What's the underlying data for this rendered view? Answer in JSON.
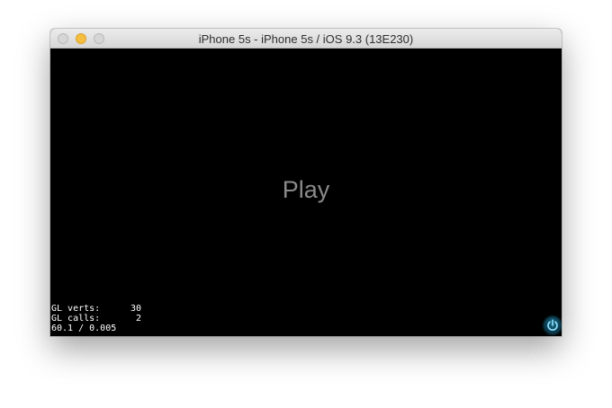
{
  "window": {
    "title": "iPhone 5s - iPhone 5s / iOS 9.3 (13E230)"
  },
  "screen": {
    "play_label": "Play",
    "stats": {
      "gl_verts_label": "GL verts:",
      "gl_verts_value": "30",
      "gl_calls_label": "GL calls:",
      "gl_calls_value": "2",
      "fps_line": "60.1 / 0.005"
    },
    "power_icon": "power-icon"
  },
  "colors": {
    "traffic_minimize": "#f5be3f",
    "screen_background": "#000000",
    "play_text": "#8a8a8a",
    "power_accent": "#1ea0cc"
  }
}
